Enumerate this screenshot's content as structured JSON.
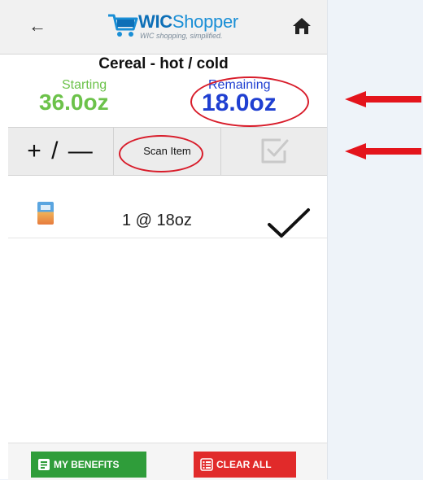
{
  "header": {
    "app_name_bold": "WIC",
    "app_name_rest": "Shopper",
    "tagline": "WIC shopping, simplified.",
    "back_icon": "arrow-left-icon",
    "home_icon": "home-icon",
    "logo_icon": "cart-icon"
  },
  "category": {
    "title": "Cereal - hot / cold"
  },
  "amounts": {
    "starting_label": "Starting",
    "starting_value": "36.0oz",
    "remaining_label": "Remaining",
    "remaining_value": "18.0oz"
  },
  "toolbar": {
    "adjust_label": "+ / —",
    "scan_label": "Scan Item",
    "confirm_icon": "checkbox-icon"
  },
  "items": [
    {
      "quantity": "1 @ 18oz",
      "status_icon": "checkmark-icon"
    }
  ],
  "footer": {
    "benefits_label": "MY BENEFITS",
    "clear_label": "CLEAR ALL"
  },
  "colors": {
    "starting": "#6cc24a",
    "remaining": "#1f3fd1",
    "annotation": "#d81c2a",
    "benefits_button": "#2f9d3a",
    "clear_button": "#e12a2a"
  }
}
